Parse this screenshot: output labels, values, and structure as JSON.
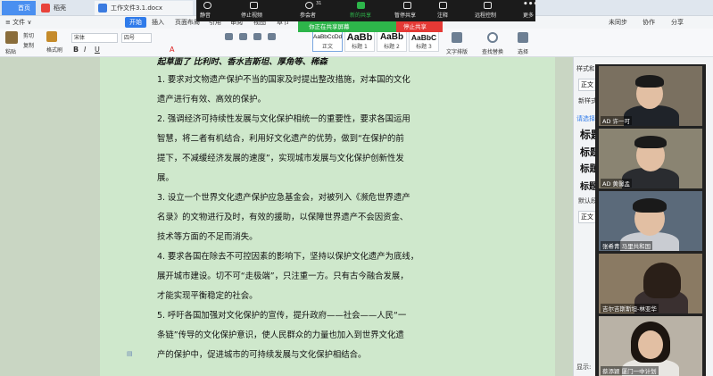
{
  "tabs": [
    {
      "label": "首页"
    },
    {
      "label": "稻壳"
    },
    {
      "label": "工作文件3.1.docx"
    }
  ],
  "menubar": {
    "file": "≡ 文件 ∨",
    "start": "开始",
    "insert": "插入",
    "layout": "页面布局",
    "ref": "引用",
    "review": "审阅",
    "view": "视图",
    "chapter": "章节",
    "right_items": [
      "未同步",
      "协作",
      "分享"
    ]
  },
  "ribbon": {
    "paste": "粘贴",
    "cut": "剪切",
    "copy": "复制",
    "format_painter": "格式刷",
    "font_name": "宋体",
    "font_size": "四号",
    "style_normal_sample": "AaBbCcDd",
    "style_normal": "正文",
    "style_h1_sample": "AaBb",
    "style_h1": "标题 1",
    "style_h2_sample": "AaBb",
    "style_h2": "标题 2",
    "style_h3_sample": "AaBbC",
    "style_h3": "标题 3",
    "text_layout": "文字排版",
    "find_replace": "查找替换",
    "select": "选择"
  },
  "zoom": {
    "mute": "静音",
    "stop_video": "停止视频",
    "participants": "参会者",
    "participant_count": "31",
    "new_share": "新的共享",
    "pause_share": "暂停共享",
    "annotate": "注释",
    "remote_control": "远程控制",
    "more": "更多",
    "sharing_label": "你正在共享屏幕",
    "stop_share": "停止共享"
  },
  "document": {
    "heading_partial": "起草面了 比利时、香水吉斯坦、厚角等、稀森",
    "lines": [
      "1. 要求对文物遗产保护不当的国家及时提出整改措施，对本国的文化",
      "遗产进行有效、高效的保护。",
      "2. 强调经济可持续性发展与文化保护相统一的重要性，要求各国运用",
      "智慧，将二者有机结合，利用好文化遗产的优势，做到“在保护的前",
      "提下，不减缓经济发展的速度”，实现城市发展与文化保护创新性发",
      "展。",
      "3. 设立一个世界文化遗产保护应急基金会，对被列入《濒危世界遗产",
      "名录》的文物进行及时，有效的援助，以保障世界遗产不会因资金、",
      "技术等方面的不足而消失。",
      "4. 要求各国在除去不可控因素的影响下，坚持以保护文化遗产为底线，",
      "展开城市建设。切不可“走极端”，只注重一方。只有古今融合发展，",
      "才能实现平衡稳定的社会。",
      "5. 呼吁各国加强对文化保护的宣传，提升政府——社会——人民“一",
      "条链”传导的文化保护意识，使人民群众的力量也加入到世界文化遗",
      "产的保护中，促进城市的可持续发展与文化保护相结合。"
    ]
  },
  "right_panel": {
    "title": "样式和格式",
    "box1": "正文",
    "new_style": "新样式",
    "clear": "清除格式",
    "select_label": "请选择要应用的格式",
    "headings": [
      "标题",
      "标题",
      "标题",
      "标题"
    ],
    "default_para": "默认段落字体",
    "box2": "正文",
    "show_label": "显示:"
  },
  "participants": [
    {
      "name": "AD 许一可"
    },
    {
      "name": "AD 黄馨孟"
    },
    {
      "name": "张希青 马里共和国"
    },
    {
      "name": "吉尔吉斯斯坦-林亚华"
    },
    {
      "name": "蔡添颖 厦门一中计划"
    }
  ]
}
